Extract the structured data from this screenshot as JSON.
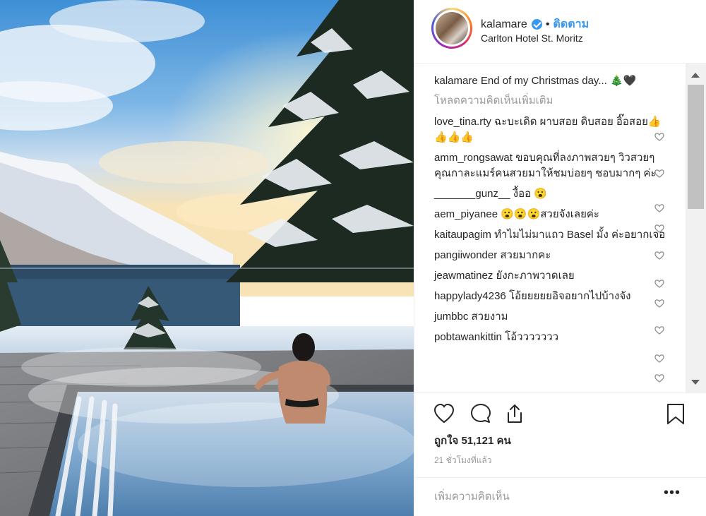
{
  "post": {
    "username": "kalamare",
    "follow_label": "ติดตาม",
    "location": "Carlton Hotel St. Moritz",
    "caption_user": "kalamare",
    "caption_text": "End of my Christmas day... 🎄🖤",
    "load_more": "โหลดความคิดเห็นเพิ่มเติม",
    "likes": "ถูกใจ 51,121 คน",
    "time": "21 ชั่วโมงที่แล้ว",
    "add_comment_placeholder": "เพิ่มความคิดเห็น",
    "more_label": "•••"
  },
  "comments": [
    {
      "user": "love_tina.rty",
      "text": "ฉะบะเดิด ผาบสอย ดิบสอย อิ๊อสอย👍👍👍👍"
    },
    {
      "user": "amm_rongsawat",
      "text": "ขอบคุณที่ลงภาพสวยๆ วิวสวยๆ คุณกาละแมร์คนสวยมาให้ชมบ่อยๆ ชอบมากๆ ค่ะ"
    },
    {
      "user": "_______gunz__",
      "text": "งื้ออ 😮"
    },
    {
      "user": "aem_piyanee",
      "text": "😮😮😮สวยจังเลยค่ะ"
    },
    {
      "user": "kaitaupagim",
      "text": "ทำไมไม่มาแถว Basel มั้ง ค่ะอยากเจอ"
    },
    {
      "user": "pangiiwonder",
      "text": "สวยมากคะ"
    },
    {
      "user": "jeawmatinez",
      "text": "ยังกะภาพวาดเลย"
    },
    {
      "user": "happylady4236",
      "text": "โอ้ยยยยยอิจอยากไปบ้างจัง"
    },
    {
      "user": "jumbbc",
      "text": "สวยงาม"
    },
    {
      "user": "pobtawankittin",
      "text": "โอ้ววววววว"
    }
  ],
  "colors": {
    "accent": "#3897f0",
    "text": "#262626",
    "muted": "#999999"
  },
  "icons": [
    "verified-icon",
    "heart-icon",
    "comment-icon",
    "share-icon",
    "bookmark-icon",
    "more-icon"
  ]
}
